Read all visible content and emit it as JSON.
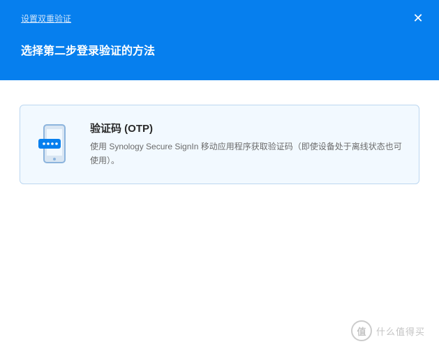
{
  "header": {
    "breadcrumb_link": "设置双重验证",
    "title": "选择第二步登录验证的方法",
    "close_label": "✕"
  },
  "option": {
    "title": "验证码 (OTP)",
    "description": "使用 Synology Secure SignIn 移动应用程序获取验证码（即使设备处于离线状态也可使用）。"
  },
  "watermark": {
    "symbol": "值",
    "text": "什么值得买"
  }
}
